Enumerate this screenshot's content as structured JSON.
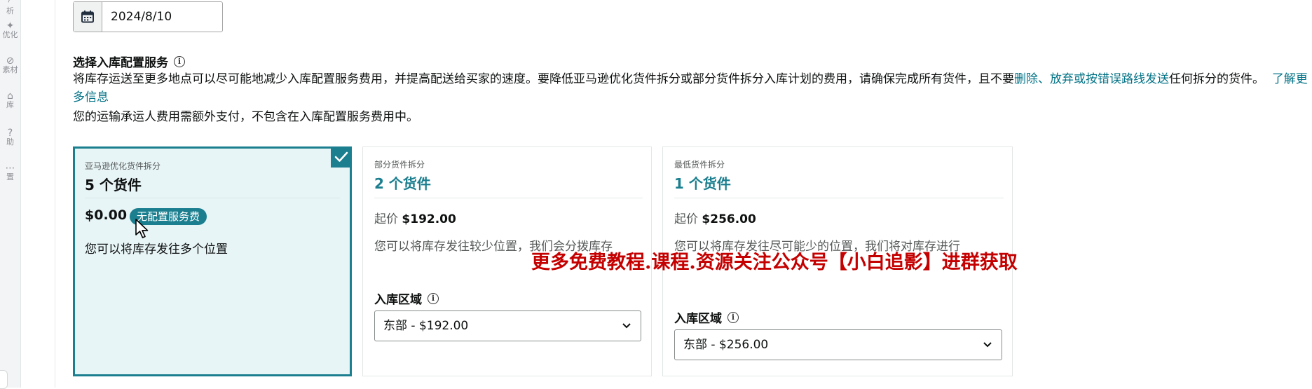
{
  "rail": {
    "items": [
      {
        "icon": "chart-icon",
        "glyph": "◜",
        "label": "析"
      },
      {
        "icon": "sparkle-icon",
        "glyph": "✦",
        "label": "优化"
      },
      {
        "icon": "material-icon",
        "glyph": "⊘",
        "label": "素材"
      },
      {
        "icon": "warehouse-icon",
        "glyph": "⌂",
        "label": "库"
      },
      {
        "icon": "help-icon",
        "glyph": "?",
        "label": "助"
      },
      {
        "icon": "more-icon",
        "glyph": "⋯",
        "label": "置"
      }
    ]
  },
  "date_field": {
    "value": "2024/8/10",
    "icon": "calendar-icon"
  },
  "section": {
    "title": "选择入库配置服务",
    "desc_part1": "将库存运送至更多地点可以尽可能地减少入库配置服务费用，并提高配送给买家的速度。要降低亚马逊优化货件拆分或部分货件拆分入库计划的费用，请确保完成所有货件，且不要",
    "link_delete": "删除",
    "sep": "、",
    "link_abandon": "放弃或按错误路线发送",
    "desc_part2": "任何拆分的货件。",
    "link_learn": "了解更多信息",
    "note": "您的运输承运人费用需额外支付，不包含在入库配置服务费用中。"
  },
  "cards": [
    {
      "subtitle": "亚马逊优化货件拆分",
      "title": "5 个货件",
      "price": "$0.00",
      "badge": "无配置服务费",
      "desc": "您可以将库存发往多个位置",
      "selected": true
    },
    {
      "subtitle": "部分货件拆分",
      "title": "2 个货件",
      "price_label": "起价",
      "price": "$192.00",
      "desc": "您可以将库存发往较少位置，我们会分拨库存",
      "region_label": "入库区域",
      "region_value": "东部 - $192.00",
      "selected": false
    },
    {
      "subtitle": "最低货件拆分",
      "title": "1 个货件",
      "price_label": "起价",
      "price": "$256.00",
      "desc": "您可以将库存发往尽可能少的位置，我们将对库存进行",
      "region_label": "入库区域",
      "region_value": "东部 - $256.00",
      "selected": false
    }
  ],
  "overlay_text": "更多免费教程.课程.资源关注公众号【小白追影】进群获取",
  "colors": {
    "accent": "#1b7f8f",
    "link": "#007185",
    "overlay": "#c40000"
  }
}
